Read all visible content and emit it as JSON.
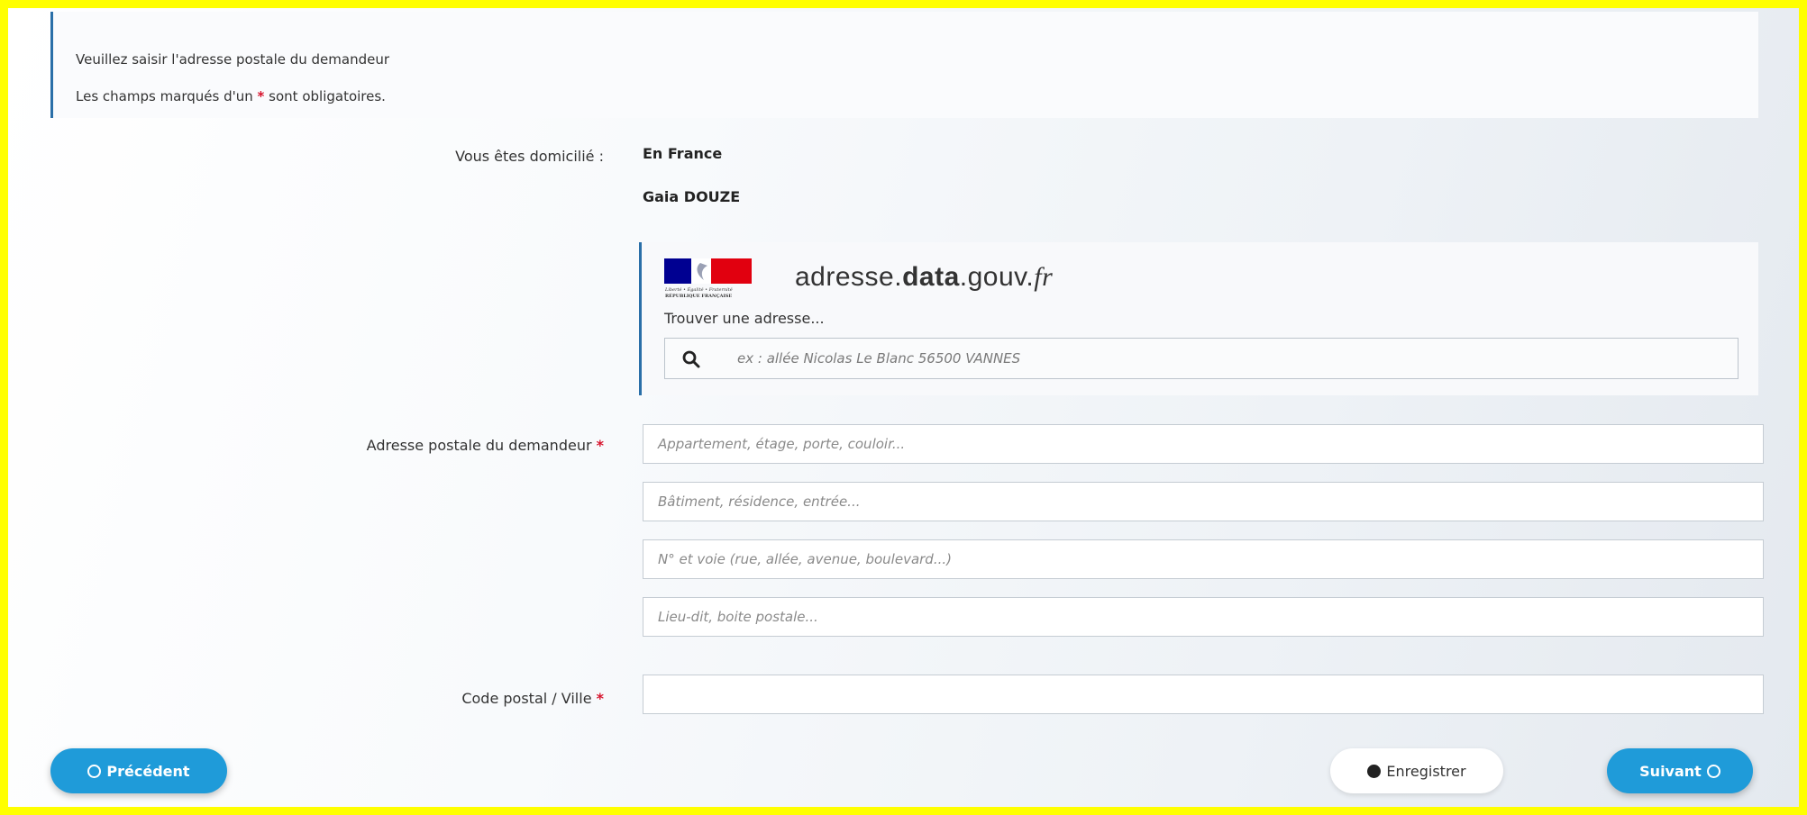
{
  "intro": {
    "line1": "Veuillez saisir l'adresse postale du demandeur",
    "line2_before": "Les champs marqués d'un ",
    "line2_star": "*",
    "line2_after": " sont obligatoires."
  },
  "domicile": {
    "label": "Vous êtes domicilié :",
    "value": "En France",
    "name": "Gaia DOUZE"
  },
  "ban": {
    "logo_caption_top": "Liberté • Égalité • Fraternité",
    "logo_caption_bottom": "RÉPUBLIQUE FRANÇAISE",
    "title_part1": "adresse.",
    "title_part2": "data",
    "title_part3": ".gouv.",
    "title_part4": "fr",
    "find_label": "Trouver une adresse...",
    "search_placeholder": "ex : allée Nicolas Le Blanc 56500 VANNES"
  },
  "address": {
    "label": "Adresse postale du demandeur",
    "required_mark": "*",
    "line1_placeholder": "Appartement, étage, porte, couloir...",
    "line2_placeholder": "Bâtiment, résidence, entrée...",
    "line3_placeholder": "N° et voie (rue, allée, avenue, boulevard...)",
    "line4_placeholder": "Lieu-dit, boite postale..."
  },
  "city": {
    "label": "Code postal / Ville",
    "required_mark": "*",
    "value": ""
  },
  "buttons": {
    "previous": "Précédent",
    "save": "Enregistrer",
    "next": "Suivant"
  },
  "colors": {
    "frame": "#ffff00",
    "accent_blue": "#1f9bd9",
    "required_red": "#d7142d",
    "border_blue": "#2a6fa8"
  }
}
